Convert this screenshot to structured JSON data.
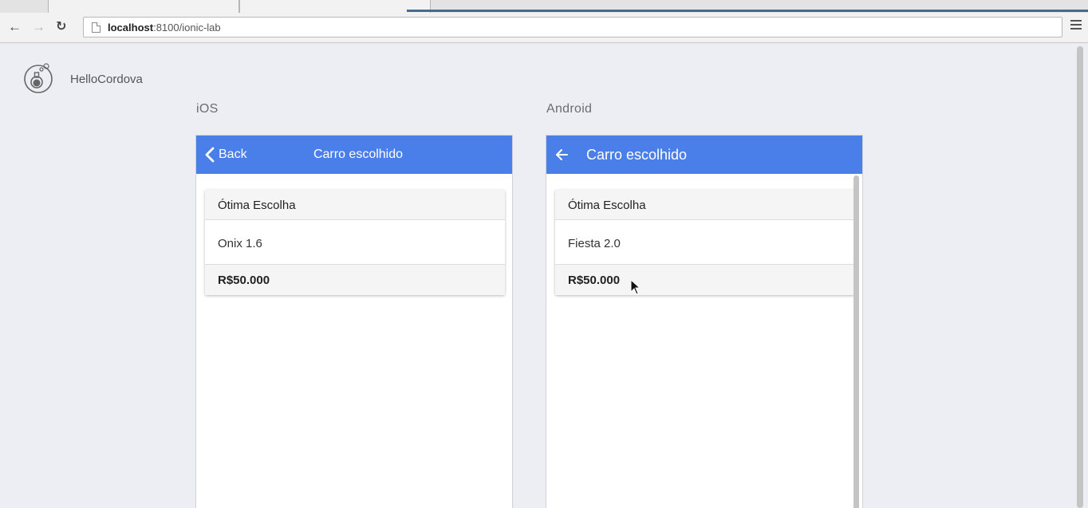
{
  "browser": {
    "url_host": "localhost",
    "url_path": ":8100/ionic-lab",
    "icons": {
      "back": "arrow-left-icon",
      "forward": "arrow-right-icon",
      "reload": "reload-icon",
      "page": "page-icon",
      "menu": "hamburger-menu-icon"
    }
  },
  "lab": {
    "app_name": "HelloCordova",
    "logo_icon": "ionic-flask-icon"
  },
  "ios": {
    "platform_label": "iOS",
    "back_label": "Back",
    "title": "Carro escolhido",
    "card": {
      "header": "Ótima Escolha",
      "content": "Onix 1.6",
      "footer": "R$50.000"
    }
  },
  "android": {
    "platform_label": "Android",
    "title": "Carro escolhido",
    "card": {
      "header": "Ótima Escolha",
      "content": "Fiesta 2.0",
      "footer": "R$50.000"
    }
  },
  "colors": {
    "navbar": "#4a7fe9",
    "page_background": "#eceef4"
  }
}
